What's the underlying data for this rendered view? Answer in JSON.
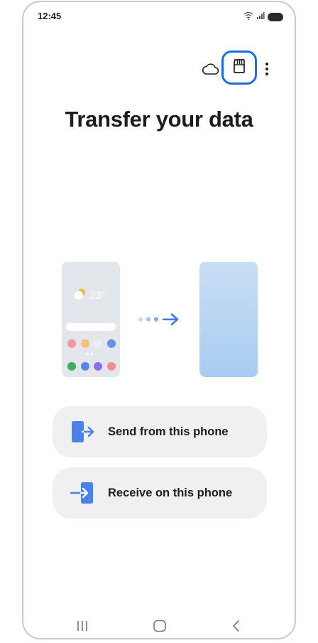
{
  "status_bar": {
    "time": "12:45",
    "icons": [
      "wifi-icon",
      "signal-icon",
      "battery-icon"
    ]
  },
  "toolbar": {
    "icons": [
      "cloud-icon",
      "sd-card-icon",
      "more-options-icon"
    ],
    "highlight_color": "#1a6fe0"
  },
  "page": {
    "title": "Transfer your data"
  },
  "illustration": {
    "old_phone": {
      "temperature": "23°",
      "app_colors_row1": [
        "#f09a9a",
        "#f5c07a",
        "#dfe9f5",
        "#6d8ee6"
      ],
      "app_colors_row2": [
        "#3fae5a",
        "#5a86e0",
        "#8a6ee6",
        "#f08f8f"
      ]
    },
    "transfer_arrow_color": "#3a7be8"
  },
  "options": [
    {
      "label": "Send from this phone",
      "icon": "send-phone-icon"
    },
    {
      "label": "Receive on this phone",
      "icon": "receive-phone-icon"
    }
  ],
  "nav_bar": {
    "icons": [
      "recents-icon",
      "home-icon",
      "back-icon"
    ]
  }
}
